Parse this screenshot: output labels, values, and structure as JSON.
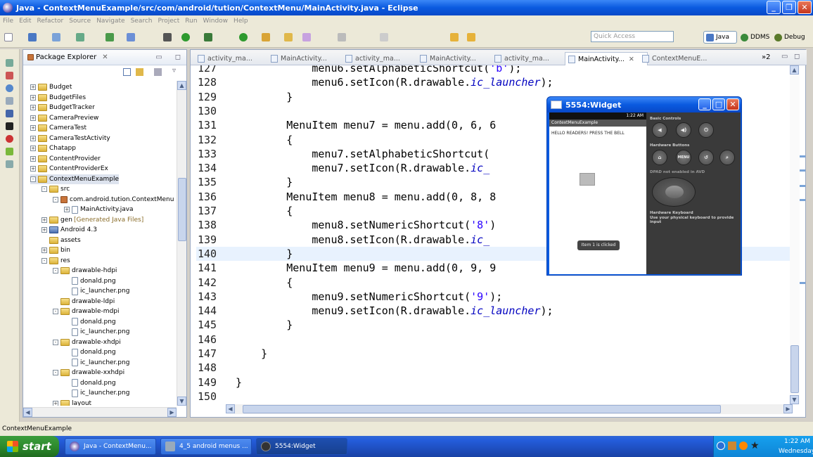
{
  "window": {
    "title": "Java - ContextMenuExample/src/com/android/tution/ContextMenu/MainActivity.java - Eclipse"
  },
  "menubar": [
    "File",
    "Edit",
    "Refactor",
    "Source",
    "Navigate",
    "Search",
    "Project",
    "Run",
    "Window",
    "Help"
  ],
  "toolbar": {
    "quick_access_placeholder": "Quick Access"
  },
  "perspectives": [
    {
      "label": "Java"
    },
    {
      "label": "DDMS"
    },
    {
      "label": "Debug"
    }
  ],
  "package_explorer": {
    "title": "Package Explorer",
    "items": [
      {
        "label": "Budget",
        "level": 0,
        "icon": "folder",
        "exp": "+"
      },
      {
        "label": "BudgetFiles",
        "level": 0,
        "icon": "folder",
        "exp": "+"
      },
      {
        "label": "BudgetTracker",
        "level": 0,
        "icon": "folder",
        "exp": "+"
      },
      {
        "label": "CameraPreview",
        "level": 0,
        "icon": "folder",
        "exp": "+"
      },
      {
        "label": "CameraTest",
        "level": 0,
        "icon": "folder",
        "exp": "+"
      },
      {
        "label": "CameraTestActivity",
        "level": 0,
        "icon": "folder",
        "exp": "+"
      },
      {
        "label": "Chatapp",
        "level": 0,
        "icon": "folder",
        "exp": "+"
      },
      {
        "label": "ContentProvider",
        "level": 0,
        "icon": "folder",
        "exp": "+"
      },
      {
        "label": "ContentProviderEx",
        "level": 0,
        "icon": "folder",
        "exp": "+"
      },
      {
        "label": "ContextMenuExample",
        "level": 0,
        "icon": "folder",
        "exp": "-",
        "selected": true
      },
      {
        "label": "src",
        "level": 1,
        "icon": "folder",
        "exp": "-"
      },
      {
        "label": "com.android.tution.ContextMenu",
        "level": 2,
        "icon": "pkg",
        "exp": "-"
      },
      {
        "label": "MainActivity.java",
        "level": 3,
        "icon": "file",
        "exp": "+"
      },
      {
        "label": "gen",
        "suffix": "[Generated Java Files]",
        "level": 1,
        "icon": "folder",
        "exp": "+"
      },
      {
        "label": "Android 4.3",
        "level": 1,
        "icon": "lib",
        "exp": "+"
      },
      {
        "label": "assets",
        "level": 1,
        "icon": "folder",
        "exp": ""
      },
      {
        "label": "bin",
        "level": 1,
        "icon": "folder",
        "exp": "+"
      },
      {
        "label": "res",
        "level": 1,
        "icon": "folder",
        "exp": "-"
      },
      {
        "label": "drawable-hdpi",
        "level": 2,
        "icon": "folder",
        "exp": "-"
      },
      {
        "label": "donald.png",
        "level": 3,
        "icon": "file",
        "exp": ""
      },
      {
        "label": "ic_launcher.png",
        "level": 3,
        "icon": "file",
        "exp": ""
      },
      {
        "label": "drawable-ldpi",
        "level": 2,
        "icon": "folder",
        "exp": ""
      },
      {
        "label": "drawable-mdpi",
        "level": 2,
        "icon": "folder",
        "exp": "-"
      },
      {
        "label": "donald.png",
        "level": 3,
        "icon": "file",
        "exp": ""
      },
      {
        "label": "ic_launcher.png",
        "level": 3,
        "icon": "file",
        "exp": ""
      },
      {
        "label": "drawable-xhdpi",
        "level": 2,
        "icon": "folder",
        "exp": "-"
      },
      {
        "label": "donald.png",
        "level": 3,
        "icon": "file",
        "exp": ""
      },
      {
        "label": "ic_launcher.png",
        "level": 3,
        "icon": "file",
        "exp": ""
      },
      {
        "label": "drawable-xxhdpi",
        "level": 2,
        "icon": "folder",
        "exp": "-"
      },
      {
        "label": "donald.png",
        "level": 3,
        "icon": "file",
        "exp": ""
      },
      {
        "label": "ic_launcher.png",
        "level": 3,
        "icon": "file",
        "exp": ""
      },
      {
        "label": "layout",
        "level": 2,
        "icon": "folder",
        "exp": "+"
      }
    ]
  },
  "editor_tabs": [
    {
      "label": "activity_ma..."
    },
    {
      "label": "MainActivity..."
    },
    {
      "label": "activity_ma..."
    },
    {
      "label": "MainActivity..."
    },
    {
      "label": "activity_ma..."
    },
    {
      "label": "MainActivity...",
      "active": true
    },
    {
      "label": "ContextMenuE..."
    }
  ],
  "editor_tabs_overflow": "»2",
  "code_lines": [
    {
      "n": "127",
      "segs": [
        {
          "t": "            menu6.setAlphabeticShortcut("
        },
        {
          "t": "'b'",
          "c": "st"
        },
        {
          "t": ");"
        }
      ]
    },
    {
      "n": "128",
      "segs": [
        {
          "t": "            menu6.setIcon(R.drawable."
        },
        {
          "t": "ic_launcher",
          "c": "it"
        },
        {
          "t": ");"
        }
      ]
    },
    {
      "n": "129",
      "segs": [
        {
          "t": "        }"
        }
      ]
    },
    {
      "n": "130",
      "segs": [
        {
          "t": ""
        }
      ]
    },
    {
      "n": "131",
      "segs": [
        {
          "t": "        MenuItem menu7 = menu.add(0, 6, 6"
        }
      ]
    },
    {
      "n": "132",
      "segs": [
        {
          "t": "        {"
        }
      ]
    },
    {
      "n": "133",
      "segs": [
        {
          "t": "            menu7.setAlphabeticShortcut("
        }
      ]
    },
    {
      "n": "134",
      "segs": [
        {
          "t": "            menu7.setIcon(R.drawable."
        },
        {
          "t": "ic_",
          "c": "it"
        }
      ]
    },
    {
      "n": "135",
      "segs": [
        {
          "t": "        }"
        }
      ]
    },
    {
      "n": "136",
      "segs": [
        {
          "t": "        MenuItem menu8 = menu.add(0, 8, 8"
        }
      ]
    },
    {
      "n": "137",
      "segs": [
        {
          "t": "        {"
        }
      ]
    },
    {
      "n": "138",
      "segs": [
        {
          "t": "            menu8.setNumericShortcut("
        },
        {
          "t": "'8'",
          "c": "st"
        },
        {
          "t": ")"
        }
      ]
    },
    {
      "n": "139",
      "segs": [
        {
          "t": "            menu8.setIcon(R.drawable."
        },
        {
          "t": "ic_",
          "c": "it"
        }
      ]
    },
    {
      "n": "140",
      "segs": [
        {
          "t": "        }"
        }
      ],
      "hl": true
    },
    {
      "n": "141",
      "segs": [
        {
          "t": "        MenuItem menu9 = menu.add(0, 9, 9"
        }
      ]
    },
    {
      "n": "142",
      "segs": [
        {
          "t": "        {"
        }
      ]
    },
    {
      "n": "143",
      "segs": [
        {
          "t": "            menu9.setNumericShortcut("
        },
        {
          "t": "'9'",
          "c": "st"
        },
        {
          "t": ");"
        }
      ]
    },
    {
      "n": "144",
      "segs": [
        {
          "t": "            menu9.setIcon(R.drawable."
        },
        {
          "t": "ic_launcher",
          "c": "it"
        },
        {
          "t": ");"
        }
      ]
    },
    {
      "n": "145",
      "segs": [
        {
          "t": "        }"
        }
      ]
    },
    {
      "n": "146",
      "segs": [
        {
          "t": ""
        }
      ]
    },
    {
      "n": "147",
      "segs": [
        {
          "t": "    }"
        }
      ]
    },
    {
      "n": "148",
      "segs": [
        {
          "t": ""
        }
      ]
    },
    {
      "n": "149",
      "segs": [
        {
          "t": "}"
        }
      ]
    },
    {
      "n": "150",
      "segs": [
        {
          "t": ""
        }
      ]
    }
  ],
  "emulator": {
    "title": "5554:Widget",
    "status_time": "1:22 AM",
    "app_title": "ContextMenuExample",
    "hello_text": "HELLO READERS! PRESS THE BELL",
    "toast": "Item 1 is clicked",
    "basic_controls_label": "Basic Controls",
    "hardware_buttons_label": "Hardware Buttons",
    "dpad_label": "DPAD not enabled in AVD",
    "keyboard_label": "Hardware Keyboard",
    "keyboard_hint": "Use your physical keyboard to provide input",
    "menu_button": "MENU"
  },
  "statusbar": {
    "text": "ContextMenuExample"
  },
  "taskbar": {
    "start": "start",
    "buttons": [
      {
        "label": "Java - ContextMenu..."
      },
      {
        "label": "4_5 android menus ..."
      },
      {
        "label": "5554:Widget",
        "active": true
      }
    ],
    "clock_time": "1:22 AM",
    "clock_day": "Wednesday"
  }
}
